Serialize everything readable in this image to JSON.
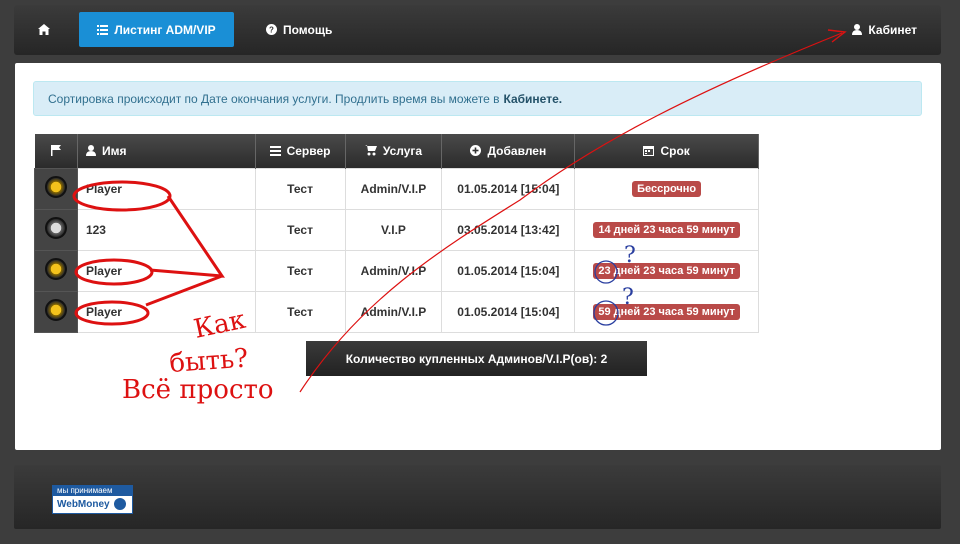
{
  "navbar": {
    "listing": "Листинг ADM/VIP",
    "help": "Помощь",
    "cabinet": "Кабинет"
  },
  "alert": {
    "text": "Сортировка происходит по Дате окончания услуги. Продлить время вы можете в",
    "link": "Кабинете."
  },
  "table": {
    "headers": [
      "Имя",
      "Сервер",
      "Услуга",
      "Добавлен",
      "Срок"
    ],
    "rows": [
      {
        "badge": "gold",
        "name": "Player",
        "server": "Тест",
        "service": "Admin/V.I.P",
        "added": "01.05.2014 [15:04]",
        "term": "Бессрочно"
      },
      {
        "badge": "silver",
        "name": "123",
        "server": "Тест",
        "service": "V.I.P",
        "added": "03.05.2014 [13:42]",
        "term": "14 дней 23 часа 59 минут"
      },
      {
        "badge": "gold",
        "name": "Player",
        "server": "Тест",
        "service": "Admin/V.I.P",
        "added": "01.05.2014 [15:04]",
        "term": "23 дней 23 часа 59 минут"
      },
      {
        "badge": "gold",
        "name": "Player",
        "server": "Тест",
        "service": "Admin/V.I.P",
        "added": "01.05.2014 [15:04]",
        "term": "59 дней 23 часа 59 минут"
      }
    ]
  },
  "summary": "Количество купленных Админов/V.I.P(ов): 2",
  "footer": {
    "webmoney_top": "мы принимаем",
    "webmoney_bottom": "WebMoney"
  },
  "annotations": {
    "line1": "Как",
    "line2": "быть?",
    "line3": "Всё просто",
    "question_mark": "?"
  },
  "colors": {
    "accent": "#1a8fd6",
    "alert_bg": "#d9edf7",
    "term_label": "#b94a48",
    "annotation": "#dd1111"
  }
}
